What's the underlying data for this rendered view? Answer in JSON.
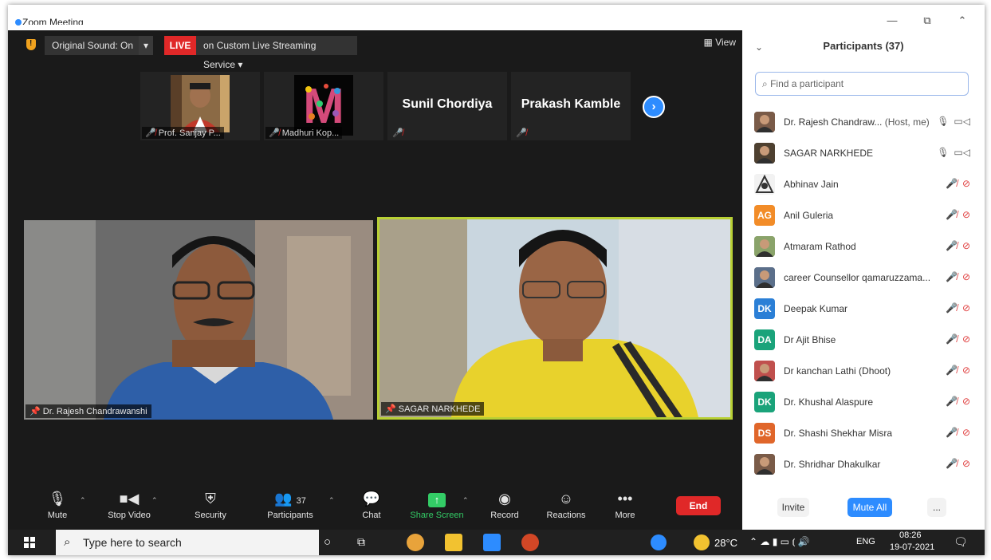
{
  "window": {
    "title": "Zoom Meeting",
    "controls": {
      "minimize": "—",
      "restore": "⧉",
      "collapse": "⌃"
    }
  },
  "topbar": {
    "original_sound": "Original Sound: On",
    "live_badge": "LIVE",
    "streaming": "on Custom Live Streaming Service",
    "view": "View"
  },
  "filmstrip": [
    {
      "name": "Prof. Sanjay P...",
      "type": "photo"
    },
    {
      "name": "Madhuri Kop...",
      "type": "logo",
      "logo_letter": "M"
    },
    {
      "name": "Sunil Chordiya",
      "type": "text"
    },
    {
      "name": "Prakash Kamble",
      "type": "text"
    }
  ],
  "videos": [
    {
      "name": "Dr. Rajesh Chandrawanshi",
      "active_speaker": false
    },
    {
      "name": "SAGAR NARKHEDE",
      "active_speaker": true
    }
  ],
  "toolbar": {
    "mute": "Mute",
    "stop_video": "Stop Video",
    "security": "Security",
    "participants": "Participants",
    "participants_count": "37",
    "chat": "Chat",
    "share_screen": "Share Screen",
    "record": "Record",
    "reactions": "Reactions",
    "more": "More",
    "end": "End"
  },
  "panel": {
    "title": "Participants (37)",
    "search_placeholder": "Find a participant",
    "participants": [
      {
        "name": "Dr. Rajesh Chandraw...",
        "tag": "(Host, me)",
        "avatar": "photo",
        "color": "#7a5b48",
        "mic": "on",
        "video": "on"
      },
      {
        "name": "SAGAR NARKHEDE",
        "tag": "",
        "avatar": "photo",
        "color": "#4e4030",
        "mic": "on",
        "video": "on"
      },
      {
        "name": "Abhinav Jain",
        "tag": "",
        "avatar": "logo",
        "color": "#e8e8e8",
        "mic": "off",
        "video": "off"
      },
      {
        "name": "Anil Guleria",
        "tag": "",
        "avatar": "AG",
        "color": "#f28c28",
        "mic": "off",
        "video": "off"
      },
      {
        "name": "Atmaram Rathod",
        "tag": "",
        "avatar": "photo",
        "color": "#8aa36a",
        "mic": "off",
        "video": "off"
      },
      {
        "name": "career Counsellor qamaruzzama...",
        "tag": "",
        "avatar": "photo",
        "color": "#5b6f8a",
        "mic": "off",
        "video": "off"
      },
      {
        "name": "Deepak Kumar",
        "tag": "",
        "avatar": "DK",
        "color": "#2b7fd6",
        "mic": "off",
        "video": "off"
      },
      {
        "name": "Dr Ajit Bhise",
        "tag": "",
        "avatar": "DA",
        "color": "#1aa37a",
        "mic": "off",
        "video": "off"
      },
      {
        "name": "Dr kanchan Lathi (Dhoot)",
        "tag": "",
        "avatar": "photo",
        "color": "#c0504d",
        "mic": "off",
        "video": "off"
      },
      {
        "name": "Dr. Khushal Alaspure",
        "tag": "",
        "avatar": "DK",
        "color": "#1aa37a",
        "mic": "off",
        "video": "off"
      },
      {
        "name": "Dr. Shashi Shekhar Misra",
        "tag": "",
        "avatar": "DS",
        "color": "#e0662a",
        "mic": "off",
        "video": "off"
      },
      {
        "name": "Dr. Shridhar Dhakulkar",
        "tag": "",
        "avatar": "photo",
        "color": "#7a5b48",
        "mic": "off",
        "video": "off"
      }
    ],
    "invite": "Invite",
    "mute_all": "Mute All",
    "more": "..."
  },
  "taskbar": {
    "search_placeholder": "Type here to search",
    "weather": "28°C",
    "lang": "ENG",
    "time": "08:26",
    "date": "19-07-2021"
  }
}
